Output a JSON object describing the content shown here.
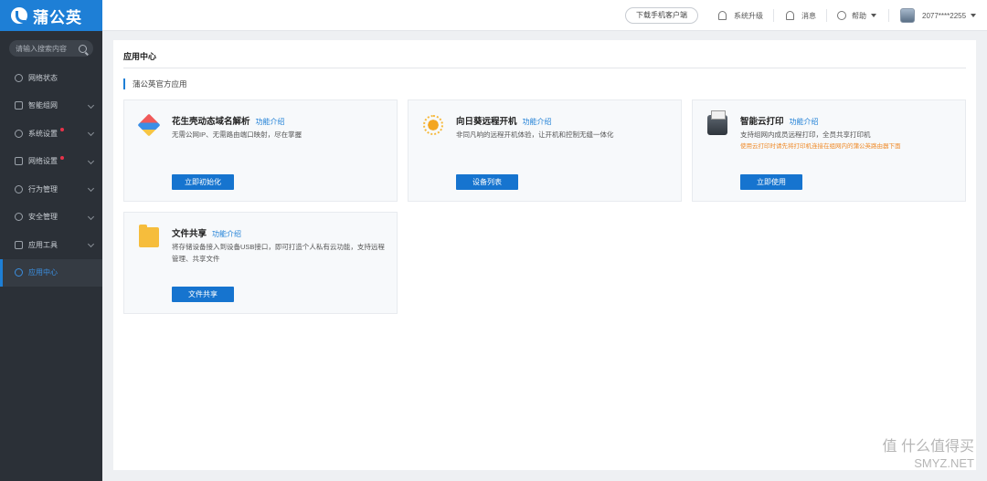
{
  "app": {
    "logo_text": "蒲公英"
  },
  "sidebar": {
    "search_placeholder": "请输入搜索内容",
    "items": [
      {
        "label": "网络状态"
      },
      {
        "label": "智能组网"
      },
      {
        "label": "系统设置"
      },
      {
        "label": "网络设置"
      },
      {
        "label": "行为管理"
      },
      {
        "label": "安全管理"
      },
      {
        "label": "应用工具"
      },
      {
        "label": "应用中心"
      }
    ]
  },
  "topbar": {
    "download_label": "下载手机客户端",
    "upgrade_label": "系统升级",
    "messages_label": "消息",
    "help_label": "帮助",
    "account_label": "2077****2255"
  },
  "main": {
    "page_title": "应用中心",
    "section_title": "蒲公英官方应用",
    "cards": [
      {
        "title": "花生壳动态域名解析",
        "link": "功能介绍",
        "desc": "无需公网IP、无需路由端口映射，尽在掌握",
        "button": "立即初始化"
      },
      {
        "title": "向日葵远程开机",
        "link": "功能介绍",
        "desc": "非同凡响的远程开机体验，让开机和控制无缝一体化",
        "button": "设备列表"
      },
      {
        "title": "智能云打印",
        "link": "功能介绍",
        "desc": "支持组网内成员远程打印，全员共享打印机",
        "warning": "使用云打印时请先将打印机连接在组网内的蒲公英路由器下面",
        "button": "立即使用"
      },
      {
        "title": "文件共享",
        "link": "功能介绍",
        "desc": "将存储设备接入到设备USB接口，即可打造个人私有云功能，支持远程管理、共享文件",
        "button": "文件共享"
      }
    ]
  },
  "watermark": {
    "line1": "值 什么值得买",
    "line2": "SMYZ.NET"
  }
}
